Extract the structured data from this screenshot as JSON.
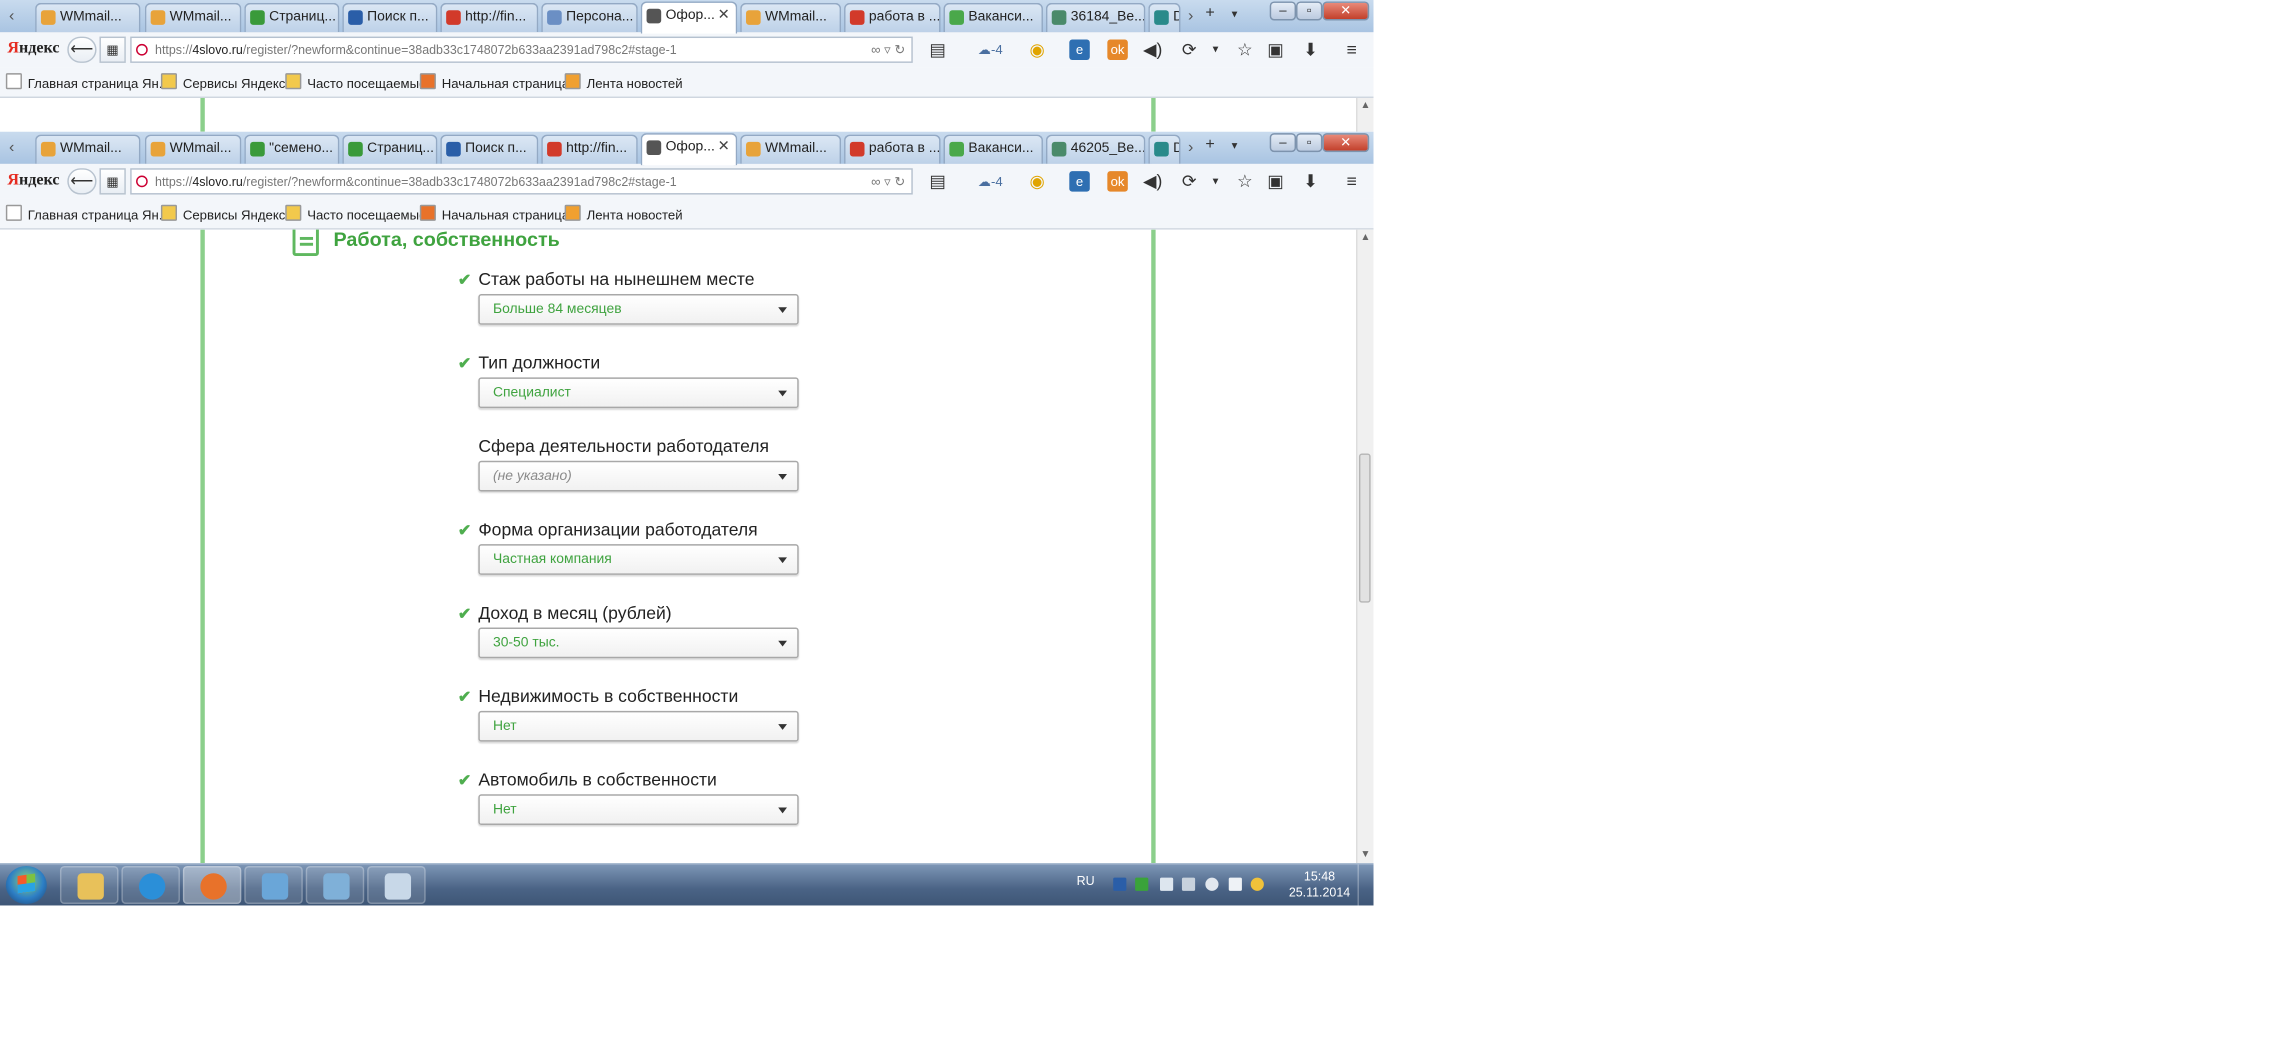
{
  "browser_back": {
    "tabs": [
      {
        "label": "WMmail...",
        "icon": "wmmail-icon",
        "color": "#e8a33a"
      },
      {
        "label": "WMmail...",
        "icon": "wmmail-icon",
        "color": "#e8a33a"
      },
      {
        "label": "Страниц...",
        "icon": "k-icon",
        "color": "#3a9a3a"
      },
      {
        "label": "Поиск п...",
        "icon": "k-icon",
        "color": "#2a5ea8"
      },
      {
        "label": "http://fin...",
        "icon": "yandex-icon",
        "color": "#d23a2a"
      },
      {
        "label": "Персона...",
        "icon": "globe-icon",
        "color": "#6b8fc4"
      },
      {
        "label": "Офор...",
        "icon": "page-icon",
        "color": "#555555"
      },
      {
        "label": "WMmail...",
        "icon": "wmmail-icon",
        "color": "#e8a33a"
      },
      {
        "label": "работа в ...",
        "icon": "yandex-icon",
        "color": "#d23a2a"
      },
      {
        "label": "Ваканси...",
        "icon": "leaf-icon",
        "color": "#4aa84a"
      },
      {
        "label": "36184_Be...",
        "icon": "image-icon",
        "color": "#4a8a6a"
      },
      {
        "label": "D",
        "icon": "site-icon",
        "color": "#2a8a8a"
      }
    ],
    "active_tab": 6,
    "url_prefix": "https://",
    "url_host": "4slovo.ru",
    "url_rest": "/register/?newform&continue=38adb33c1748072b633aa2391ad798c2#stage-1"
  },
  "browser_front": {
    "tabs": [
      {
        "label": "WMmail...",
        "icon": "wmmail-icon",
        "color": "#e8a33a"
      },
      {
        "label": "WMmail...",
        "icon": "wmmail-icon",
        "color": "#e8a33a"
      },
      {
        "label": "\"семено...",
        "icon": "k-icon",
        "color": "#3a9a3a"
      },
      {
        "label": "Страниц...",
        "icon": "k-icon",
        "color": "#3a9a3a"
      },
      {
        "label": "Поиск п...",
        "icon": "k-icon",
        "color": "#2a5ea8"
      },
      {
        "label": "http://fin...",
        "icon": "yandex-icon",
        "color": "#d23a2a"
      },
      {
        "label": "Офор...",
        "icon": "page-icon",
        "color": "#555555"
      },
      {
        "label": "WMmail...",
        "icon": "wmmail-icon",
        "color": "#e8a33a"
      },
      {
        "label": "работа в ...",
        "icon": "yandex-icon",
        "color": "#d23a2a"
      },
      {
        "label": "Ваканси...",
        "icon": "leaf-icon",
        "color": "#4aa84a"
      },
      {
        "label": "46205_Be...",
        "icon": "image-icon",
        "color": "#4a8a6a"
      },
      {
        "label": "D",
        "icon": "site-icon",
        "color": "#2a8a8a"
      }
    ],
    "active_tab": 6,
    "url_prefix": "https://",
    "url_host": "4slovo.ru",
    "url_rest": "/register/?newform&continue=38adb33c1748072b633aa2391ad798c2#stage-1"
  },
  "toolbar": {
    "logo_first": "Я",
    "logo_rest": "ндекс",
    "weather": "-4",
    "new_tab_symbol": "+",
    "menu_symbol": "≡"
  },
  "bookmarks": [
    {
      "label": "Главная страница Ян...",
      "icon": "page-icon"
    },
    {
      "label": "Сервисы Яндекса",
      "icon": "folder-icon"
    },
    {
      "label": "Часто посещаемые",
      "icon": "folder-icon"
    },
    {
      "label": "Начальная страница",
      "icon": "firefox-icon"
    },
    {
      "label": "Лента новостей",
      "icon": "rss-icon"
    }
  ],
  "page": {
    "section_title": "Работа, собственность",
    "fields": [
      {
        "label": "Стаж работы на нынешнем месте",
        "value": "Больше 84 месяцев",
        "checked": true
      },
      {
        "label": "Тип должности",
        "value": "Специалист",
        "checked": true
      },
      {
        "label": "Сфера деятельности работодателя",
        "value": "(не указано)",
        "checked": false
      },
      {
        "label": "Форма организации работодателя",
        "value": "Частная компания",
        "checked": true
      },
      {
        "label": "Доход в месяц (рублей)",
        "value": "30-50 тыс.",
        "checked": true
      },
      {
        "label": "Недвижимость в собственности",
        "value": "Нет",
        "checked": true
      },
      {
        "label": "Автомобиль в собственности",
        "value": "Нет",
        "checked": true
      }
    ],
    "accent_color": "#3fa33f",
    "scroll_fraction": 0.46
  },
  "taskbar": {
    "apps": [
      "explorer",
      "internet-explorer",
      "firefox",
      "notebook",
      "photo-viewer",
      "paint"
    ],
    "active_app": 2,
    "language": "RU",
    "time": "15:48",
    "date": "25.11.2014"
  }
}
